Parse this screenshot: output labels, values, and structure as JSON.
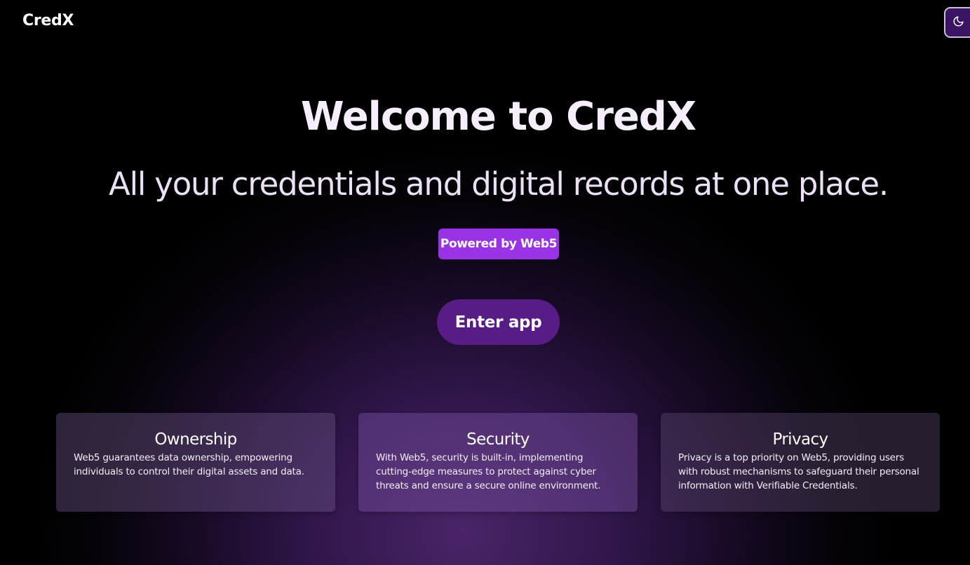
{
  "brand": {
    "name": "CredX"
  },
  "theme_toggle": {
    "icon": "moon-icon"
  },
  "hero": {
    "title": "Welcome to CredX",
    "subtitle": "All your credentials and digital records at one place.",
    "badge": "Powered by Web5",
    "cta_label": "Enter app"
  },
  "features": [
    {
      "title": "Ownership",
      "text": "Web5 guarantees data ownership, empowering individuals to control their digital assets and data."
    },
    {
      "title": "Security",
      "text": "With Web5, security is built-in, implementing cutting-edge measures to protect against cyber threats and ensure a secure online environment."
    },
    {
      "title": "Privacy",
      "text": "Privacy is a top priority on Web5, providing users with robust mechanisms to safeguard their personal information with Verifiable Credentials."
    }
  ],
  "colors": {
    "accent": "#9a32e6",
    "cta": "#581c87",
    "toggle_bg": "#3b1563"
  }
}
